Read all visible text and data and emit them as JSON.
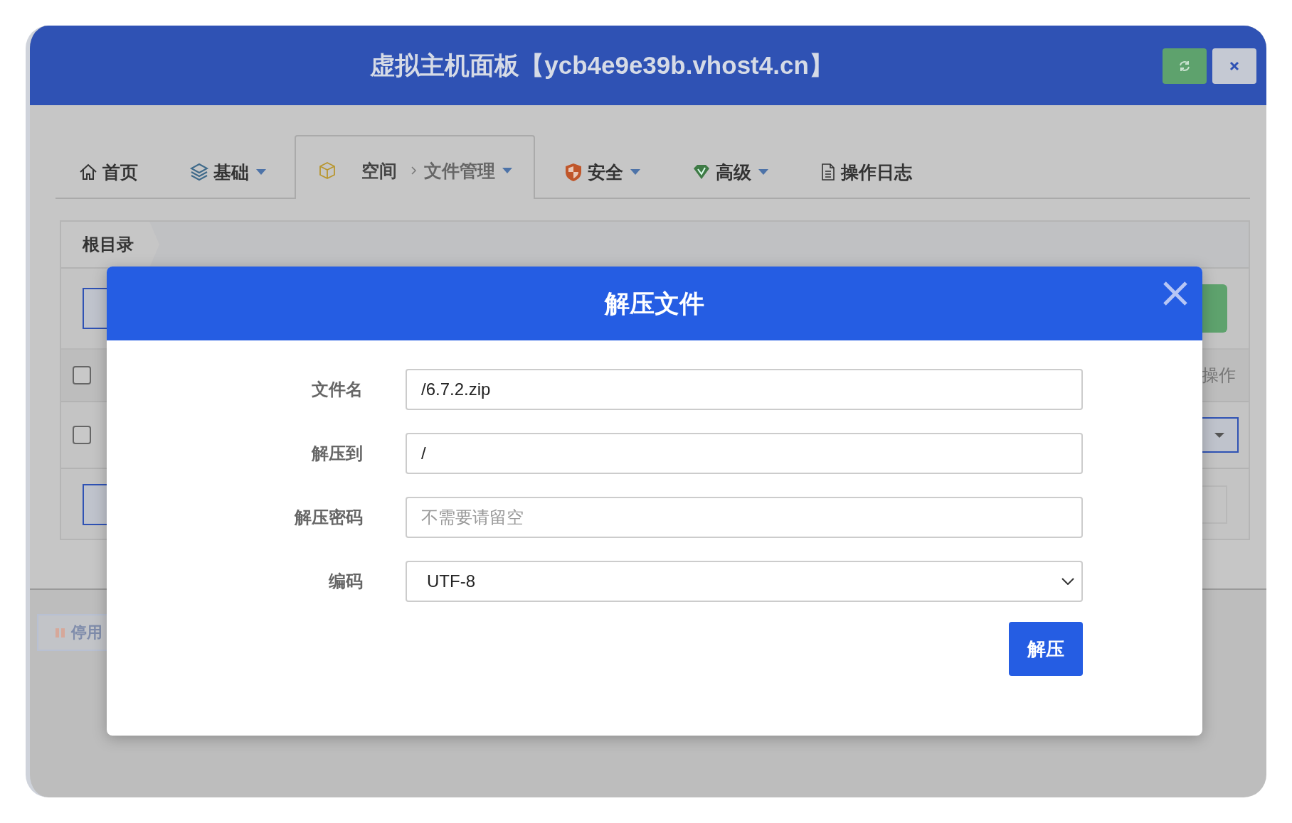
{
  "panel": {
    "title": "虚拟主机面板【ycb4e9e39b.vhost4.cn】",
    "buttons": [
      {
        "kind": "refresh"
      },
      {
        "kind": "close"
      }
    ]
  },
  "tabs": [
    {
      "kind": "home",
      "label": "首页",
      "dropdown": false,
      "selected": false
    },
    {
      "kind": "layers",
      "label": "基础",
      "dropdown": true,
      "selected": false
    },
    {
      "kind": "cube",
      "label": "空间",
      "sublabel": "文件管理",
      "dropdown": true,
      "selected": true
    },
    {
      "kind": "shield",
      "label": "安全",
      "dropdown": true,
      "selected": false
    },
    {
      "kind": "gem",
      "label": "高级",
      "dropdown": true,
      "selected": false
    },
    {
      "kind": "doc",
      "label": "操作日志",
      "dropdown": false,
      "selected": false
    }
  ],
  "breadcrumb": [
    "根目录"
  ],
  "table": {
    "header": {
      "checked": false,
      "actions": "操作"
    },
    "rows": [
      {
        "checked": false
      }
    ]
  },
  "background": {
    "button": "停用"
  },
  "dialog": {
    "title": "解压文件",
    "fields": [
      {
        "kind": "text",
        "label": "文件名",
        "value": "/6.7.2.zip"
      },
      {
        "kind": "text",
        "label": "解压到",
        "value": "/"
      },
      {
        "kind": "text",
        "label": "解压密码",
        "placeholder": "不需要请留空"
      },
      {
        "kind": "select",
        "label": "编码",
        "value": "UTF-8"
      }
    ],
    "submit": "解压"
  }
}
